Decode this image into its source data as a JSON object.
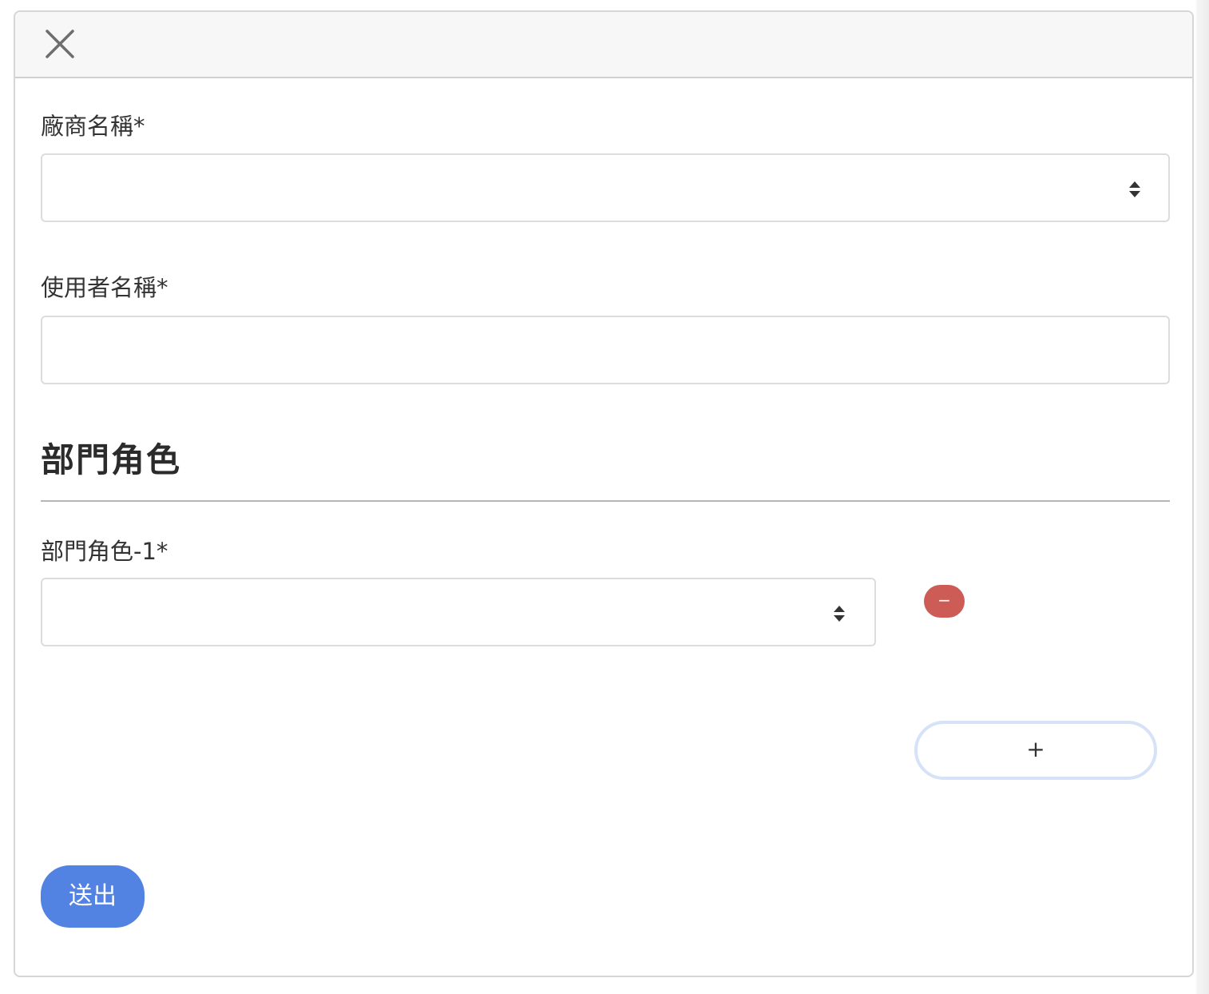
{
  "modal": {
    "close_icon": "close-icon"
  },
  "form": {
    "vendor_name": {
      "label": "廠商名稱*",
      "selected_value": "",
      "icon": "select-arrows-icon"
    },
    "user_name": {
      "label": "使用者名稱*",
      "value": "",
      "placeholder": ""
    },
    "department_roles": {
      "section_title": "部門角色",
      "items": [
        {
          "label": "部門角色-1*",
          "selected_value": "",
          "remove_label": "−",
          "icon": "select-arrows-icon"
        }
      ],
      "add_label": "+"
    },
    "submit_label": "送出"
  },
  "colors": {
    "submit_button": "#5282e2",
    "remove_button": "#cd5c56",
    "add_button_border": "#d6e2f8",
    "header_background": "#f7f7f7"
  }
}
